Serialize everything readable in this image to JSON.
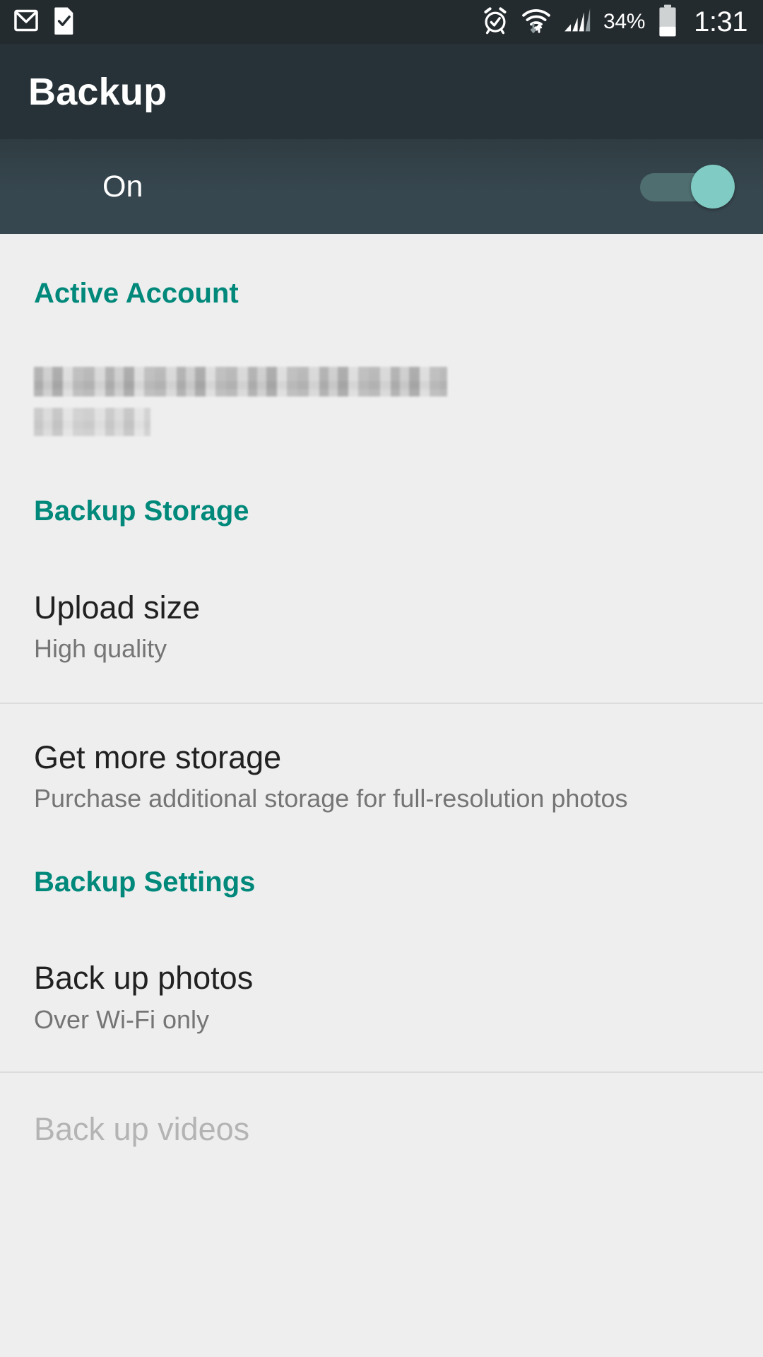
{
  "status_bar": {
    "background_color": "#242b2e",
    "left_icons": [
      {
        "name": "gmail-icon",
        "label": "Gmail"
      },
      {
        "name": "file-check-icon",
        "label": "Download complete"
      }
    ],
    "right_icons": [
      {
        "name": "alarm-icon",
        "label": "Alarm set"
      },
      {
        "name": "wifi-icon",
        "label": "Wi-Fi connected"
      },
      {
        "name": "cellular-signal-icon",
        "label": "Cellular signal"
      }
    ],
    "battery_percent": "34%",
    "clock": "1:31"
  },
  "app_bar": {
    "title": "Backup",
    "background_color": "#263238"
  },
  "master_toggle": {
    "label": "On",
    "state": "on",
    "track_color": "#4f6e70",
    "thumb_color": "#80cbc4",
    "background_color": "#37474f"
  },
  "accent_color": "#00897b",
  "sections": [
    {
      "header": "Active Account",
      "account": {
        "redacted": true,
        "line1": "",
        "line2": ""
      }
    },
    {
      "header": "Backup Storage",
      "rows": [
        {
          "title": "Upload size",
          "subtitle": "High quality",
          "enabled": true
        },
        {
          "title": "Get more storage",
          "subtitle": "Purchase additional storage for full-resolution photos",
          "enabled": true
        }
      ]
    },
    {
      "header": "Backup Settings",
      "rows": [
        {
          "title": "Back up photos",
          "subtitle": "Over Wi-Fi only",
          "enabled": true
        },
        {
          "title": "Back up videos",
          "subtitle": "",
          "enabled": false
        }
      ]
    }
  ]
}
